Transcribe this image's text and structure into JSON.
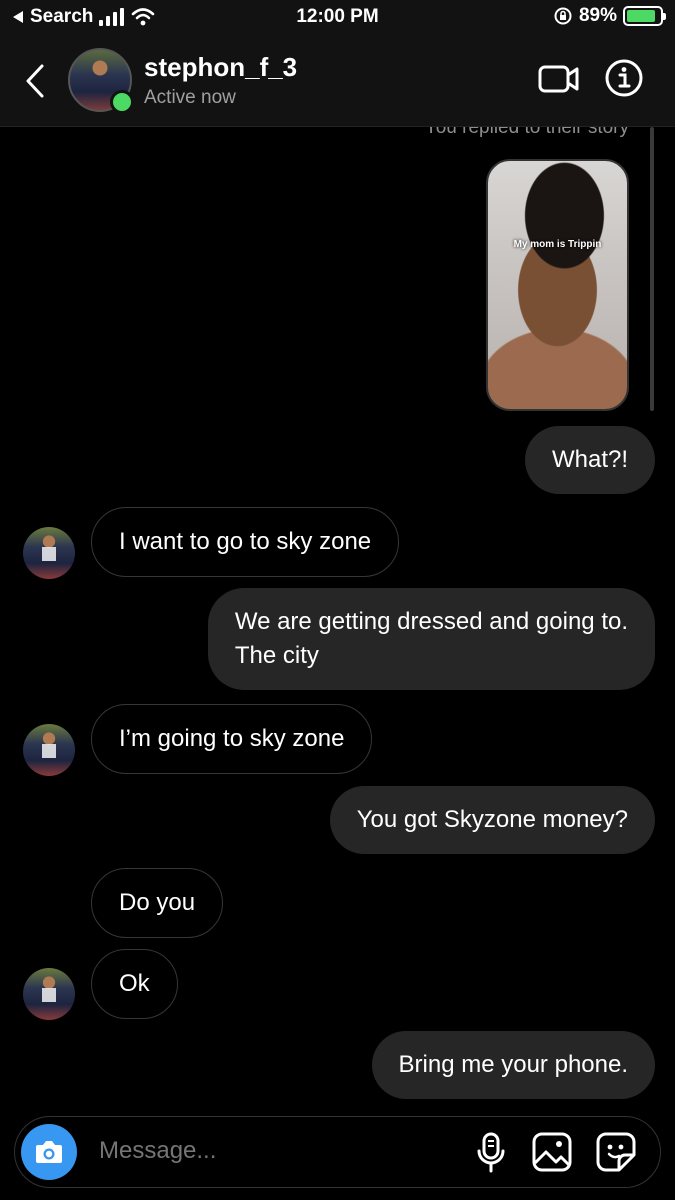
{
  "status_bar": {
    "back_app": "Search",
    "time": "12:00 PM",
    "battery": "89%"
  },
  "header": {
    "username": "stephon_f_3",
    "status": "Active now"
  },
  "thread": {
    "story_caption": "You replied to their story",
    "story_overlay_text": "My mom is Trippin",
    "messages": [
      {
        "from": "me",
        "text": "What?!"
      },
      {
        "from": "them",
        "text": "I want to go to sky zone"
      },
      {
        "from": "me",
        "text": "We are getting dressed and going to.\nThe city"
      },
      {
        "from": "them",
        "text": "I’m going to sky zone"
      },
      {
        "from": "me",
        "text": "You got Skyzone money?"
      },
      {
        "from": "them",
        "text": "Do you"
      },
      {
        "from": "them",
        "text": "Ok"
      },
      {
        "from": "me",
        "text": "Bring me your phone."
      }
    ]
  },
  "composer": {
    "placeholder": "Message..."
  },
  "colors": {
    "background": "#000000",
    "outgoing_bubble": "#262626",
    "incoming_border": "#363636",
    "online": "#4cd964",
    "camera_button": "#3897f0"
  }
}
